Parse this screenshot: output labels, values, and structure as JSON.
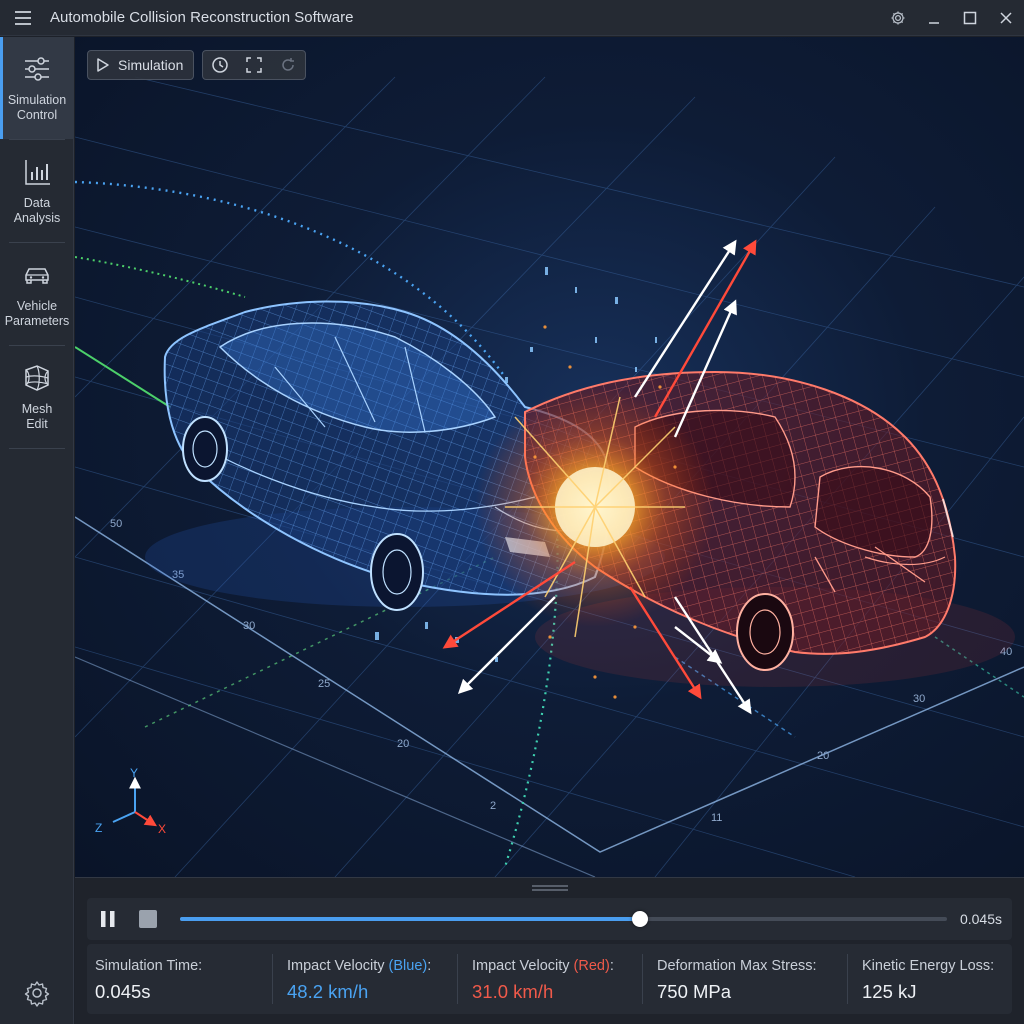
{
  "window": {
    "title": "Automobile Collision Reconstruction Software",
    "icons": [
      "menu-icon",
      "gear-icon",
      "minimize-icon",
      "maximize-icon",
      "close-icon"
    ]
  },
  "sidebar": {
    "items": [
      {
        "label": "Simulation\nControl",
        "icon": "sliders-icon",
        "active": true
      },
      {
        "label": "Data\nAnalysis",
        "icon": "bar-chart-icon",
        "active": false
      },
      {
        "label": "Vehicle\nParameters",
        "icon": "car-icon",
        "active": false
      },
      {
        "label": "Mesh\nEdit",
        "icon": "mesh-icon",
        "active": false
      }
    ],
    "footer_icon": "gear-icon"
  },
  "toolbar": {
    "simulation_label": "Simulation",
    "icons": [
      "play-icon",
      "clock-icon",
      "fullscreen-icon",
      "refresh-icon"
    ]
  },
  "scene": {
    "grid_labels_left": [
      "50",
      "35",
      "30",
      "25",
      "20",
      "2"
    ],
    "grid_labels_right": [
      "40",
      "30",
      "20",
      "11"
    ],
    "axes": {
      "y": "Y",
      "z": "Z",
      "x": "X"
    },
    "colors": {
      "blue_vehicle": "#3a8ee8",
      "red_vehicle": "#e8453a",
      "impact": "#ffb02a"
    }
  },
  "playback": {
    "progress": 0.6,
    "current_time": "0.045s",
    "icons": [
      "pause-icon",
      "stop-icon"
    ]
  },
  "stats": [
    {
      "label": "Simulation Time:",
      "label_colored": "",
      "label_end": "",
      "value": "0.045s",
      "tone": ""
    },
    {
      "label": "Impact Velocity ",
      "label_colored": "(Blue)",
      "label_end": ":",
      "value": "48.2 km/h",
      "tone": "blue"
    },
    {
      "label": "Impact Velocity ",
      "label_colored": "(Red)",
      "label_end": ":",
      "value": "31.0 km/h",
      "tone": "red"
    },
    {
      "label": "Deformation Max Stress:",
      "label_colored": "",
      "label_end": "",
      "value": "750 MPa",
      "tone": ""
    },
    {
      "label": "Kinetic Energy Loss:",
      "label_colored": "",
      "label_end": "",
      "value": "125 kJ",
      "tone": ""
    }
  ]
}
